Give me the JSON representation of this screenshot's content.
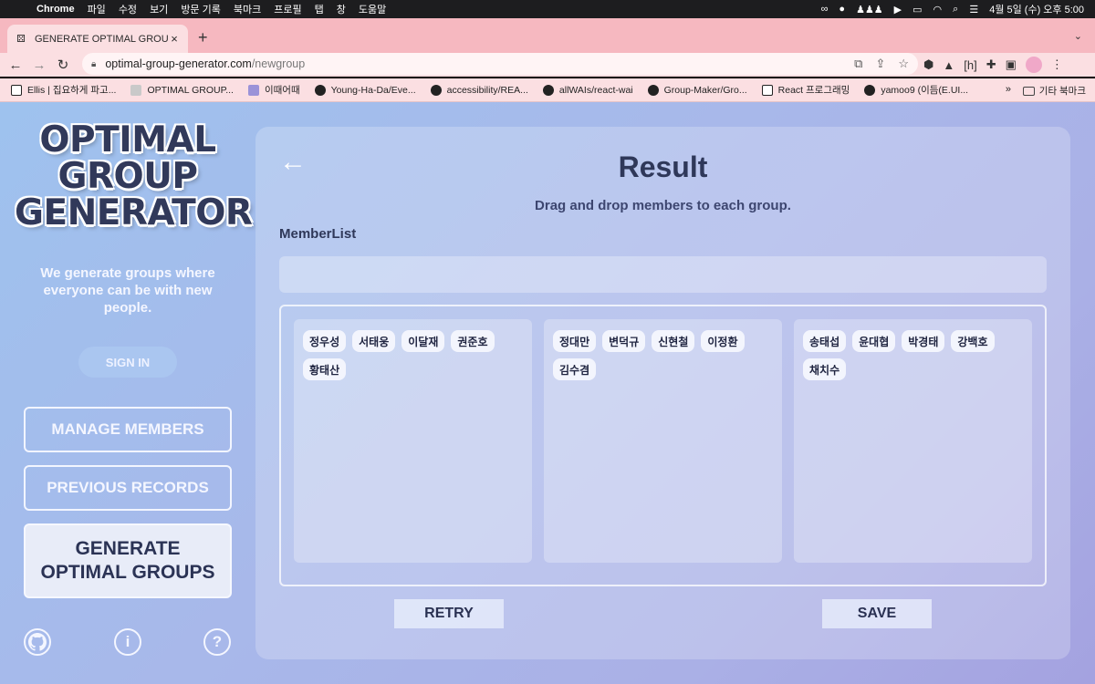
{
  "menubar": {
    "app": "Chrome",
    "items": [
      "파일",
      "수정",
      "보기",
      "방문 기록",
      "북마크",
      "프로필",
      "탭",
      "창",
      "도움말"
    ],
    "clock": "4월 5일 (수) 오후 5:00"
  },
  "tab": {
    "title": "GENERATE OPTIMAL GROUPS",
    "close": "×",
    "new": "+"
  },
  "address": {
    "host": "optimal-group-generator.com",
    "path": "/newgroup"
  },
  "bookmarks": [
    {
      "icon": "notion",
      "label": "Ellis | 집요하게 파고..."
    },
    {
      "icon": "dice",
      "label": "OPTIMAL GROUP..."
    },
    {
      "icon": "ie",
      "label": "이때어때"
    },
    {
      "icon": "gh",
      "label": "Young-Ha-Da/Eve..."
    },
    {
      "icon": "gh",
      "label": "accessibility/REA..."
    },
    {
      "icon": "gh",
      "label": "allWAIs/react-wai"
    },
    {
      "icon": "gh",
      "label": "Group-Maker/Gro..."
    },
    {
      "icon": "notion",
      "label": "React 프로그래밍"
    },
    {
      "icon": "gh",
      "label": "yamoo9 (이듬(E.UI..."
    }
  ],
  "bookmarks_more": "»",
  "bookmarks_other": "기타 북마크",
  "sidebar": {
    "logo_lines": [
      "OPTIMAL",
      "GROUP",
      "GENERATOR"
    ],
    "tagline": "We generate groups where everyone can be with new people.",
    "signin": "SIGN IN",
    "nav": {
      "manage": "MANAGE MEMBERS",
      "records": "PREVIOUS RECORDS",
      "generate": "GENERATE OPTIMAL GROUPS"
    }
  },
  "main": {
    "back": "←",
    "title": "Result",
    "subtitle": "Drag and drop members to each group.",
    "memberlist_label": "MemberList",
    "groups": [
      {
        "members": [
          "정우성",
          "서태웅",
          "이달재",
          "권준호",
          "황태산"
        ]
      },
      {
        "members": [
          "정대만",
          "변덕규",
          "신현철",
          "이정환",
          "김수겸"
        ]
      },
      {
        "members": [
          "송태섭",
          "윤대협",
          "박경태",
          "강백호",
          "채치수"
        ]
      }
    ],
    "retry": "RETRY",
    "save": "SAVE"
  }
}
